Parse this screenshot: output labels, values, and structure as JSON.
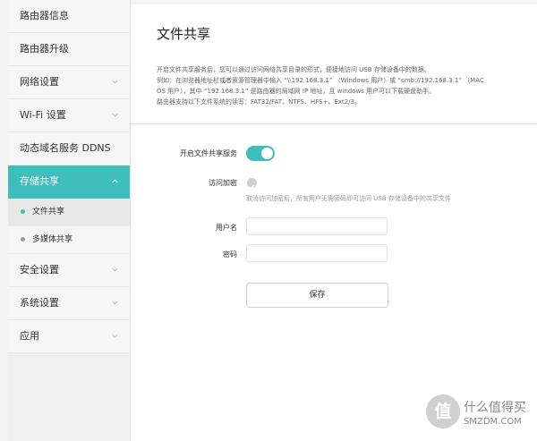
{
  "sidebar": {
    "items": [
      {
        "label": "路由器信息",
        "chevron": false
      },
      {
        "label": "路由器升级",
        "chevron": false
      },
      {
        "label": "网络设置",
        "chevron": true
      },
      {
        "label": "Wi-Fi 设置",
        "chevron": true
      },
      {
        "label": "动态域名服务 DDNS",
        "chevron": false
      },
      {
        "label": "存储共享",
        "chevron": true,
        "active": true
      },
      {
        "label": "安全设置",
        "chevron": true
      },
      {
        "label": "系统设置",
        "chevron": true
      },
      {
        "label": "应用",
        "chevron": true
      }
    ],
    "subitems": [
      {
        "label": "文件共享",
        "active": true
      },
      {
        "label": "多媒体共享",
        "active": false
      }
    ]
  },
  "main": {
    "title": "文件共享",
    "description": [
      "开启文件共享服务后，您可以通过访问网络共享目录的形式，便捷地访问 USB 存储设备中的数据。",
      "例如：在浏览器地址栏或者资源管理器中输入 “\\\\192.168.3.1” （Windows 用户）或 “smb://192.168.3.1” （MAC",
      "OS 用户），其中 “192.168.3.1” 是路由器的局域网 IP 地址，且 windows 用户可以下载硬盘助手。",
      "路由器支持以下文件系统的读写：FAT32/FAT、NTFS、HFS+、Ext2/3。"
    ],
    "toggle_label": "开启文件共享服务",
    "toggle_on": true,
    "encrypt_label": "访问加密",
    "encrypt_hint": "取消访问加密后，所有用户无需密码即可访问 USB 存储设备中的共享文件",
    "username_label": "用户名",
    "username_value": "",
    "password_label": "密码",
    "password_value": "",
    "save_label": "保存"
  },
  "watermark": {
    "icon_char": "值",
    "line1": "什么值得买",
    "line2": "SMZDM.COM"
  },
  "colors": {
    "accent": "#3ebfbd",
    "background": "#f3f3f3",
    "panel": "#ffffff"
  }
}
